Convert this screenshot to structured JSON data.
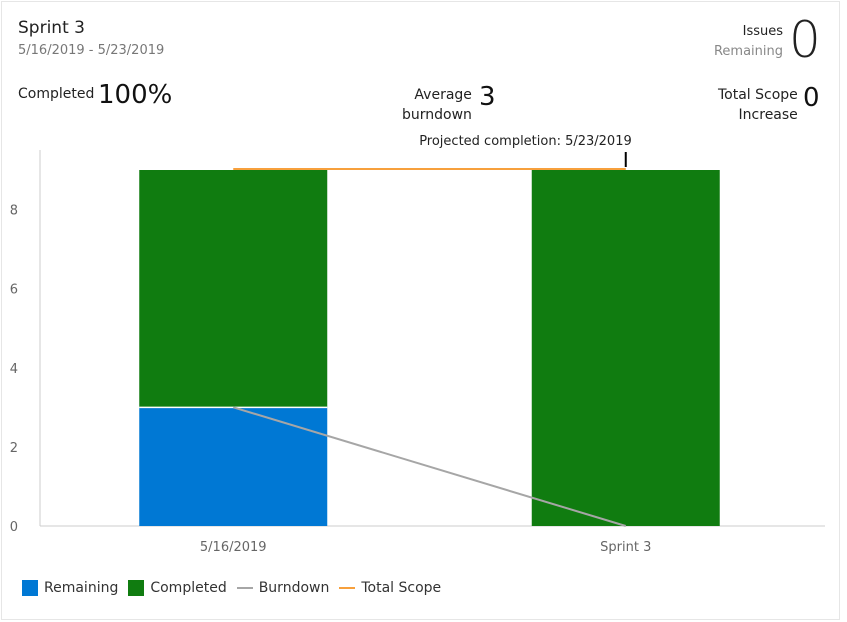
{
  "header": {
    "title": "Sprint 3",
    "date_range": "5/16/2019 - 5/23/2019",
    "issues_label_1": "Issues",
    "issues_label_2": "Remaining",
    "issues_value": "0"
  },
  "stats": {
    "completed_label": "Completed",
    "completed_value": "100%",
    "avg_label_1": "Average",
    "avg_label_2": "burndown",
    "avg_value": "3",
    "scope_label_1": "Total Scope",
    "scope_label_2": "Increase",
    "scope_value": "0"
  },
  "colors": {
    "remaining": "#0078d4",
    "completed": "#107c10",
    "burndown": "#a6a6a6",
    "total_scope": "#f7a03c",
    "axis": "#cccccc"
  },
  "chart_data": {
    "type": "bar",
    "stacked": true,
    "categories": [
      "5/16/2019",
      "Sprint 3"
    ],
    "series": [
      {
        "name": "Remaining",
        "values": [
          3,
          0
        ]
      },
      {
        "name": "Completed",
        "values": [
          6,
          9
        ]
      }
    ],
    "lines": [
      {
        "name": "Burndown",
        "values": [
          3,
          0
        ]
      },
      {
        "name": "Total Scope",
        "values": [
          9,
          9
        ]
      }
    ],
    "annotation": "Projected completion: 5/23/2019",
    "ylim": [
      0,
      9
    ],
    "yticks": [
      0,
      2,
      4,
      6,
      8
    ],
    "legend_position": "bottom-left",
    "grid": false
  }
}
